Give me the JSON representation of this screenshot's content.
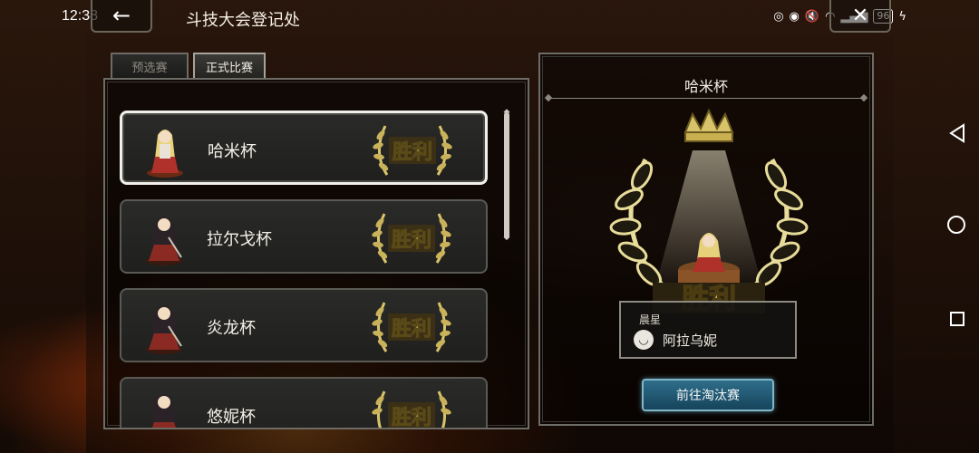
{
  "status_bar": {
    "time": "12:38",
    "battery": "96"
  },
  "header": {
    "title": "斗技大会登记处"
  },
  "tabs": [
    {
      "label": "预选赛",
      "active": false
    },
    {
      "label": "正式比赛",
      "active": true
    }
  ],
  "cups": [
    {
      "name": "哈米杯",
      "result": "胜利",
      "selected": true
    },
    {
      "name": "拉尔戈杯",
      "result": "胜利",
      "selected": false
    },
    {
      "name": "炎龙杯",
      "result": "胜利",
      "selected": false
    },
    {
      "name": "悠妮杯",
      "result": "胜利",
      "selected": false
    }
  ],
  "detail": {
    "title": "哈米杯",
    "result": "胜利",
    "winner_label": "晨星",
    "winner_name": "阿拉乌妮",
    "button_label": "前往淘汰赛"
  },
  "colors": {
    "gold": "#d9c36a",
    "button_blue": "#2f6e8a"
  }
}
